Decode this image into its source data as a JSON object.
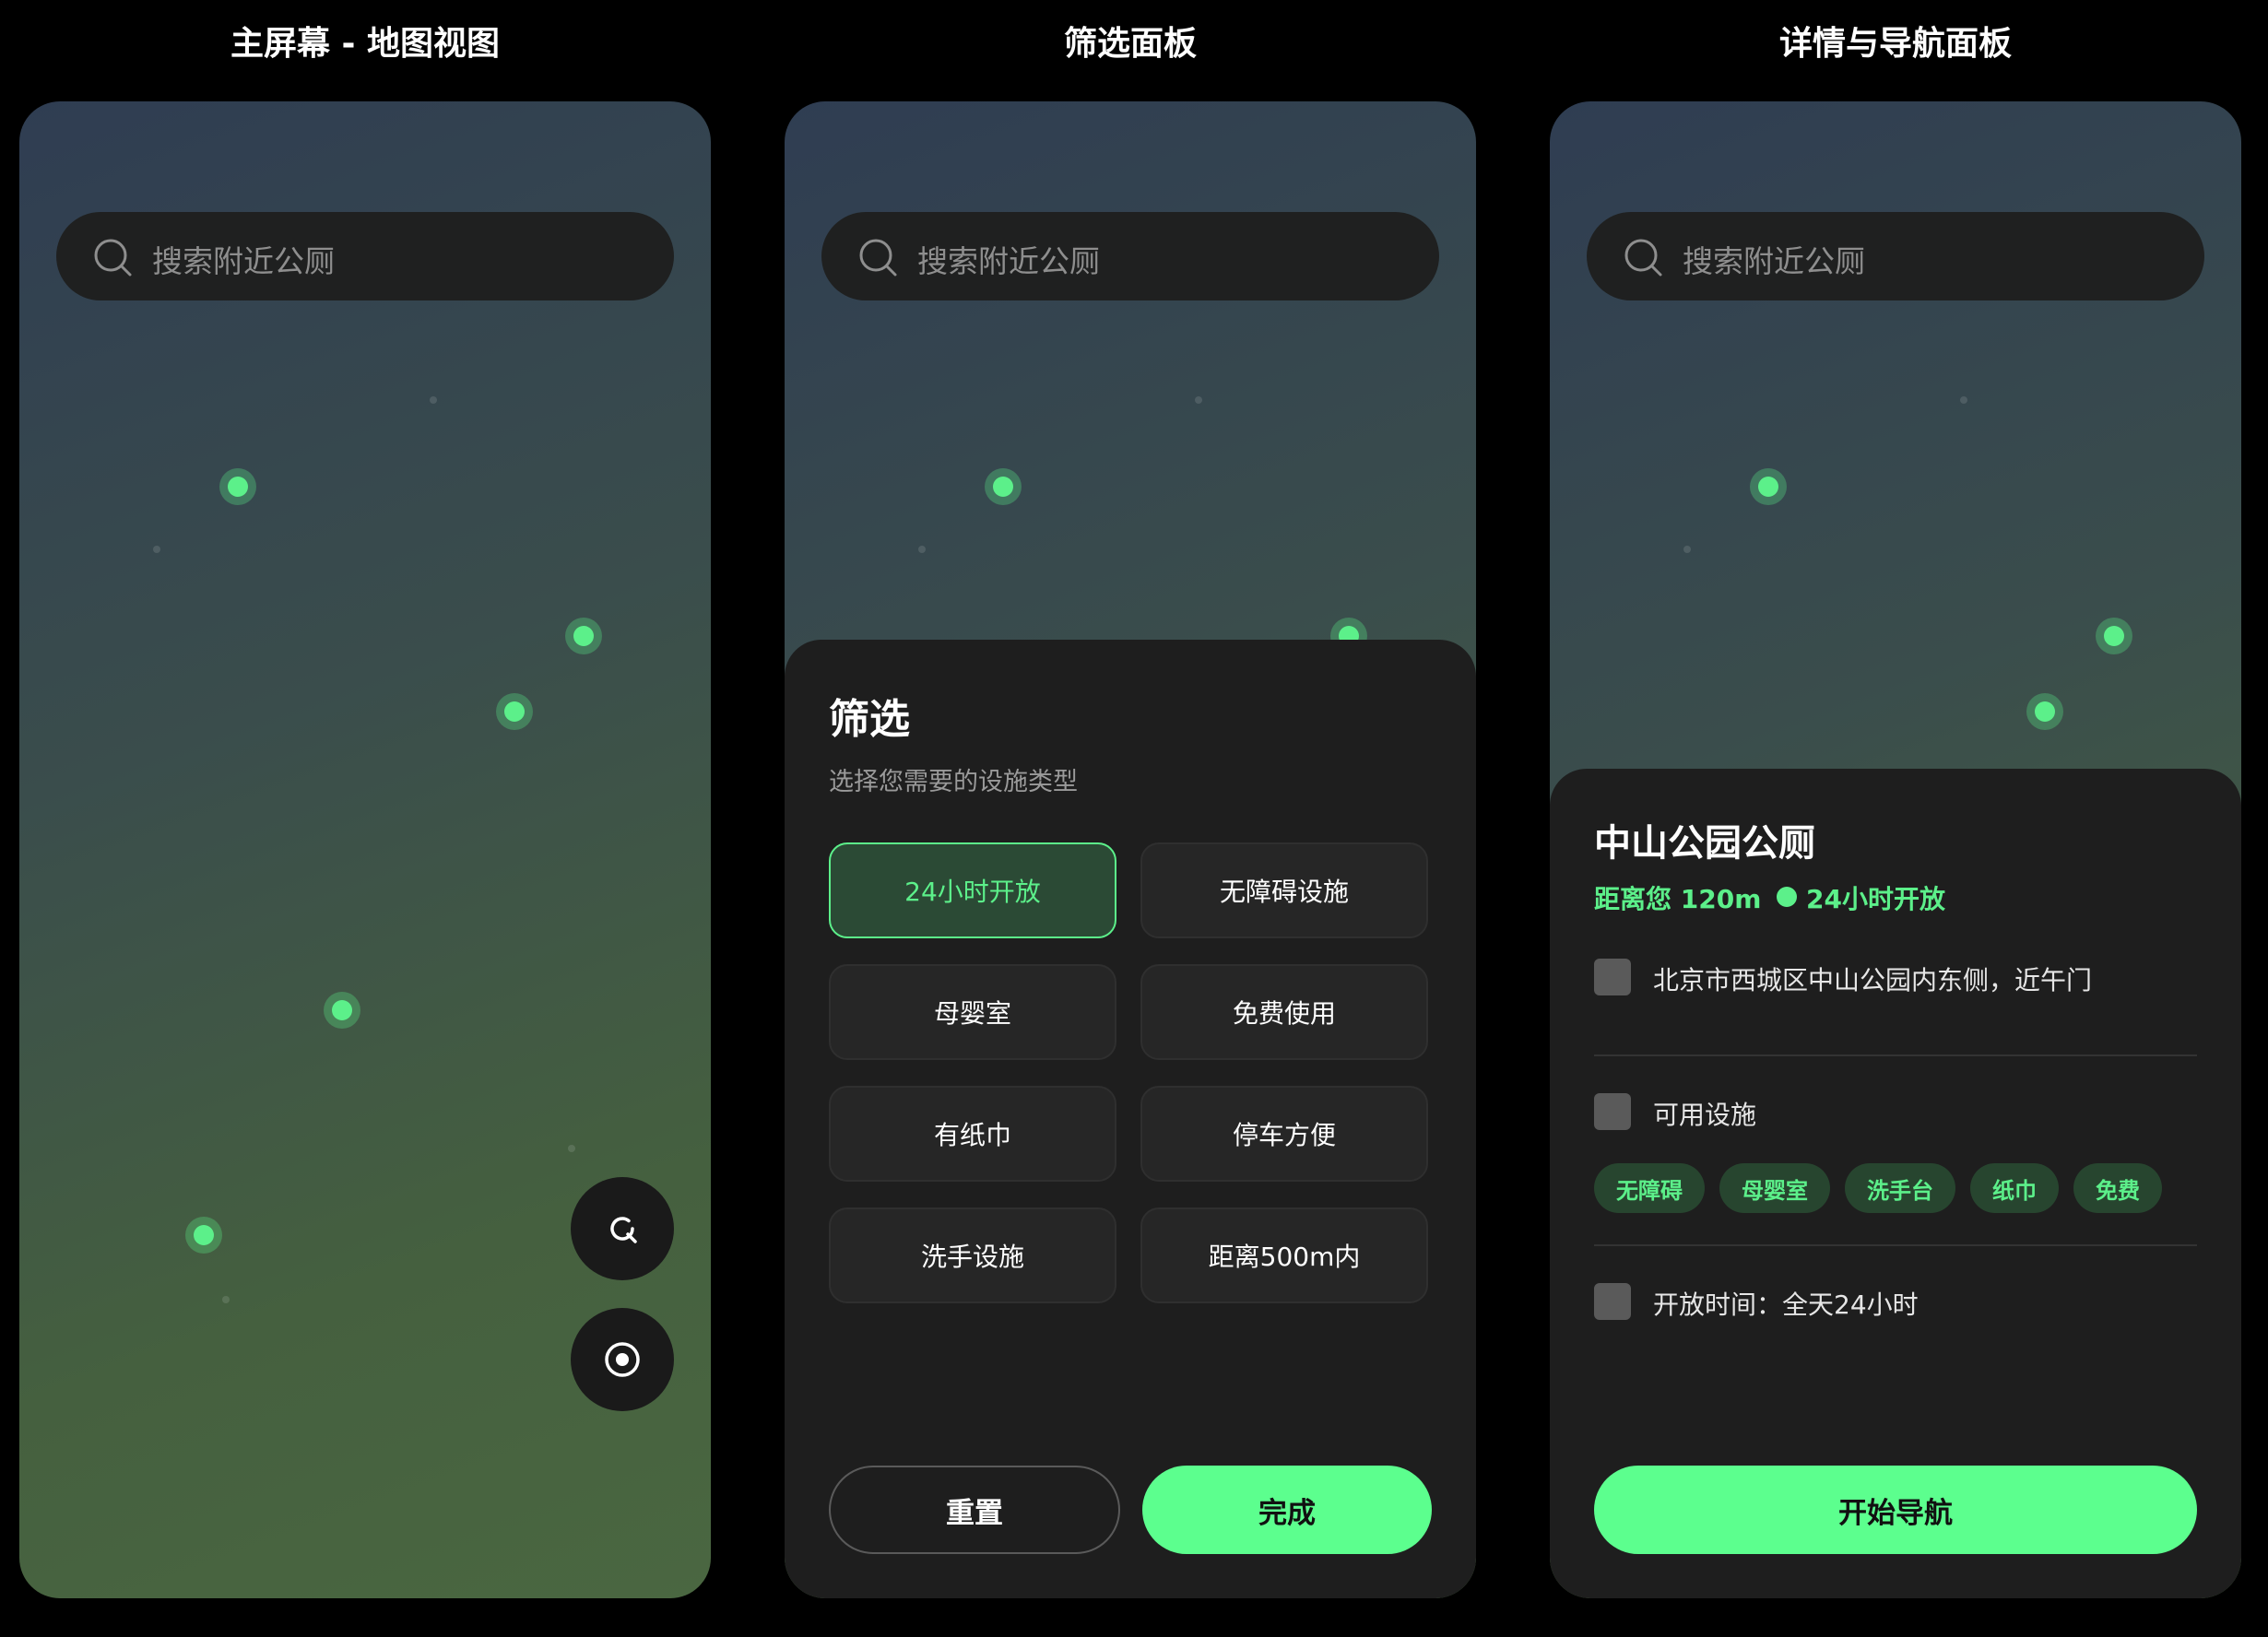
{
  "titles": {
    "col1": "主屏幕 - 地图视图",
    "col2": "筛选面板",
    "col3": "详情与导航面板"
  },
  "search": {
    "placeholder": "搜索附近公厕"
  },
  "filter": {
    "title": "筛选",
    "subtitle": "选择您需要的设施类型",
    "options": [
      {
        "label": "24小时开放",
        "selected": true
      },
      {
        "label": "无障碍设施",
        "selected": false
      },
      {
        "label": "母婴室",
        "selected": false
      },
      {
        "label": "免费使用",
        "selected": false
      },
      {
        "label": "有纸巾",
        "selected": false
      },
      {
        "label": "停车方便",
        "selected": false
      },
      {
        "label": "洗手设施",
        "selected": false
      },
      {
        "label": "距离500m内",
        "selected": false
      }
    ],
    "reset_label": "重置",
    "done_label": "完成"
  },
  "detail": {
    "name": "中山公园公厕",
    "distance": "距离您 120m",
    "hours_status": "24小时开放",
    "address": "北京市西城区中山公园内东侧，近午门",
    "facilities_label": "可用设施",
    "facility_tags": [
      "无障碍",
      "母婴室",
      "洗手台",
      "纸巾",
      "免费"
    ],
    "open_time": "开放时间：全天24小时",
    "navigate_label": "开始导航"
  },
  "icons": {
    "search": "search-icon",
    "refresh": "refresh-icon",
    "locate": "locate-icon",
    "map_pin": "map-pin-icon"
  },
  "colors": {
    "accent": "#5cff8e",
    "sheet_bg": "#1e1e1e",
    "search_bg": "#1f2020",
    "page_bg": "#000000"
  }
}
